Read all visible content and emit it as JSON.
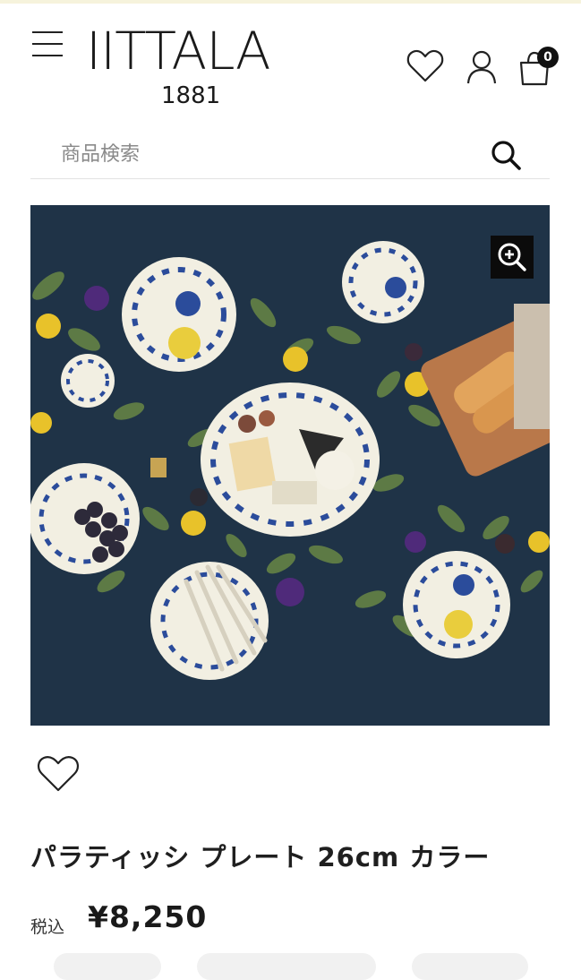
{
  "header": {
    "logo_word": "IITTALA",
    "logo_year": "1881",
    "cart_count": "0"
  },
  "search": {
    "placeholder": "商品検索"
  },
  "product": {
    "title": "パラティッシ プレート 26cm カラー",
    "tax_label": "税込",
    "price": "¥8,250"
  },
  "icons": {
    "menu": "hamburger-menu-icon",
    "wishlist": "heart-icon",
    "account": "user-icon",
    "cart": "shopping-bag-icon",
    "search": "search-icon",
    "zoom": "zoom-in-icon",
    "favorite": "heart-outline-icon"
  },
  "colors": {
    "image_background": "#1f3347",
    "text_primary": "#1f1f1f"
  }
}
